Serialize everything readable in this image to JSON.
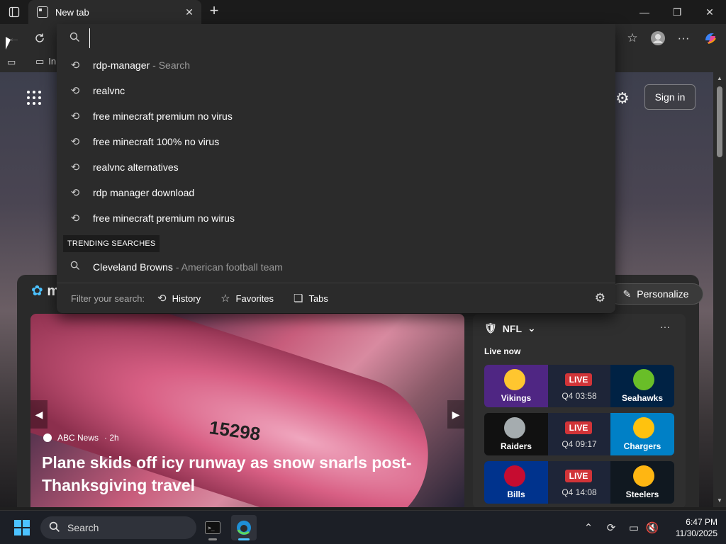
{
  "window": {
    "tab_title": "New tab",
    "tab_close": "✕",
    "new_tab": "+",
    "min": "—",
    "max": "❐",
    "close": "✕"
  },
  "favorites_bar": {
    "item_label": "In"
  },
  "omnibox": {
    "value": "",
    "placeholder": "",
    "suggestions": [
      {
        "text": "rdp-manager",
        "sub": "- Search",
        "icon": "history-icon"
      },
      {
        "text": "realvnc",
        "sub": "",
        "icon": "history-icon"
      },
      {
        "text": "free minecraft premium no virus",
        "sub": "",
        "icon": "history-icon"
      },
      {
        "text": "free minecraft 100% no virus",
        "sub": "",
        "icon": "history-icon"
      },
      {
        "text": "realvnc alternatives",
        "sub": "",
        "icon": "history-icon"
      },
      {
        "text": "rdp manager download",
        "sub": "",
        "icon": "history-icon"
      },
      {
        "text": "free minecraft premium no wirus",
        "sub": "",
        "icon": "history-icon"
      }
    ],
    "trending_label": "TRENDING SEARCHES",
    "trending": [
      {
        "text": "Cleveland Browns",
        "sub": "- American football team",
        "icon": "search-icon"
      }
    ],
    "filter_label": "Filter your search:",
    "filters": [
      "History",
      "Favorites",
      "Tabs"
    ]
  },
  "newtab": {
    "sign_in": "Sign in",
    "personalize": "Personalize",
    "msn_logo_letter": "m"
  },
  "hero": {
    "source": "ABC News",
    "age": "· 2h",
    "headline": "Plane skids off icy runway as snow snarls post-Thanksgiving travel",
    "registration": "15298",
    "left_arrow": "◀",
    "right_arrow": "▶"
  },
  "nfl": {
    "title": "NFL",
    "more": "···",
    "live_now": "Live now",
    "games": [
      {
        "home": "Vikings",
        "away": "Seahawks",
        "status": "LIVE",
        "clock": "Q4 03:58",
        "home_color": "#4f2683",
        "away_color": "#002244"
      },
      {
        "home": "Raiders",
        "away": "Chargers",
        "status": "LIVE",
        "clock": "Q4 09:17",
        "home_color": "#000000",
        "away_color": "#0080c6"
      },
      {
        "home": "Bills",
        "away": "Steelers",
        "status": "LIVE",
        "clock": "Q4 14:08",
        "home_color": "#00338d",
        "away_color": "#101820"
      }
    ]
  },
  "taskbar": {
    "search_label": "Search",
    "time": "6:47 PM",
    "date": "11/30/2025"
  },
  "colors": {
    "accent": "#4cc2ff",
    "live_red": "#d13438"
  }
}
